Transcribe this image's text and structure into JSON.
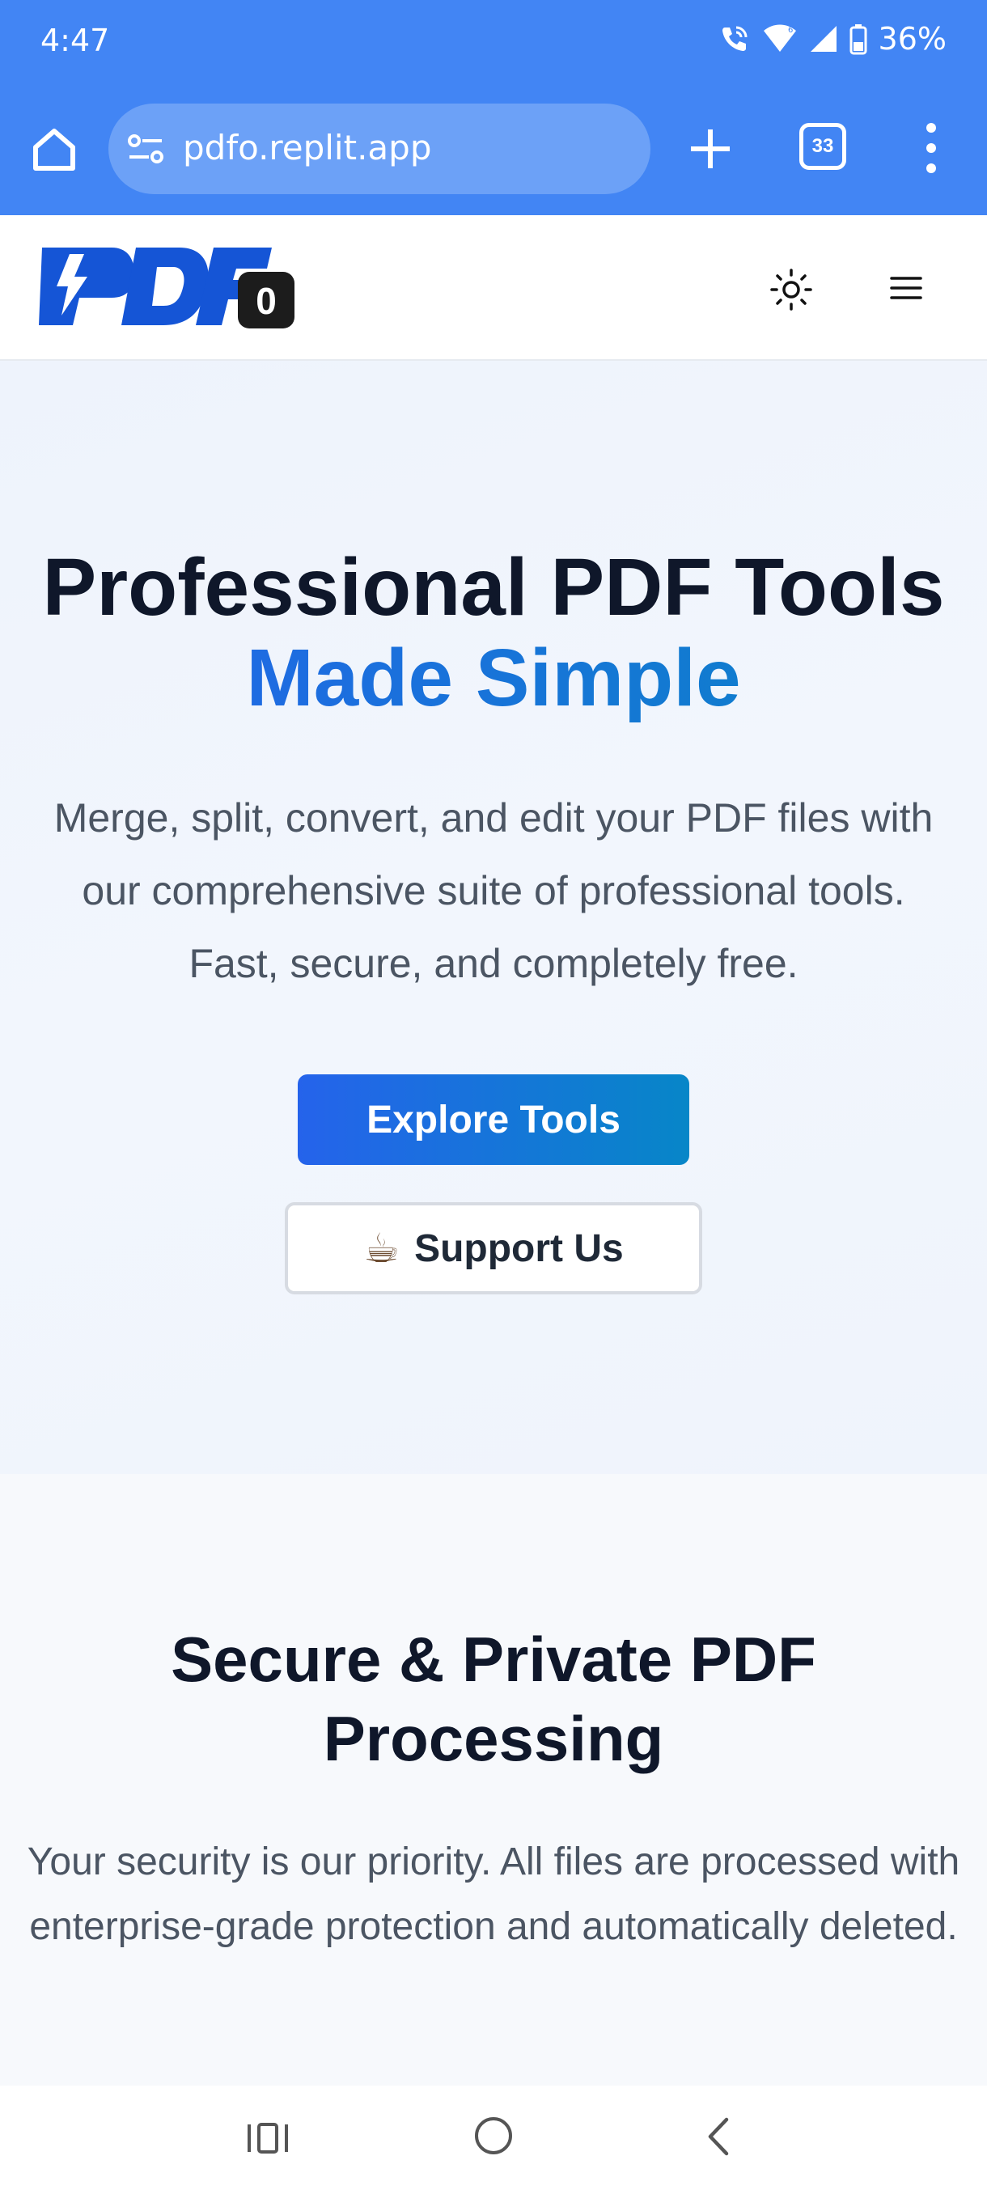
{
  "status_bar": {
    "time": "4:47",
    "battery": "36%",
    "icons": [
      "wifi-calling-icon",
      "wifi-6-icon",
      "cell-signal-icon",
      "battery-icon"
    ]
  },
  "browser": {
    "url": "pdfo.replit.app",
    "tab_count": "33",
    "toolbar_color": "#4285f4",
    "icons": [
      "home-icon",
      "site-settings-icon",
      "new-tab-icon",
      "tab-switcher-icon",
      "overflow-menu-icon"
    ]
  },
  "header": {
    "logo_text": "PDFo",
    "logo_colors": {
      "primary": "#1555d6",
      "dark": "#1c1c1c"
    },
    "icons": [
      "sun-icon",
      "hamburger-menu-icon"
    ]
  },
  "hero": {
    "title_line1": "Professional PDF Tools",
    "title_line2": "Made Simple",
    "description": "Merge, split, convert, and edit your PDF files with our comprehensive suite of professional tools. Fast, secure, and completely free.",
    "explore_button": "Explore Tools",
    "support_button": "Support Us",
    "support_icon": "☕",
    "accent_gradient": [
      "#2563eb",
      "#0786c8"
    ]
  },
  "security": {
    "title": "Secure & Private PDF Processing",
    "description": "Your security is our priority. All files are processed with enterprise-grade protection and automatically deleted."
  },
  "nav_bar": {
    "icons": [
      "recents-icon",
      "home-circle-icon",
      "back-icon"
    ]
  }
}
